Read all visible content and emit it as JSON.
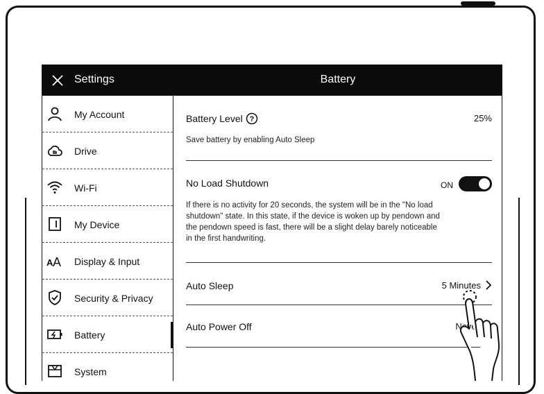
{
  "titlebar": {
    "settings_label": "Settings",
    "page_title": "Battery"
  },
  "sidebar": {
    "items": [
      {
        "label": "My Account",
        "icon": "person-icon"
      },
      {
        "label": "Drive",
        "icon": "cloud-icon"
      },
      {
        "label": "Wi-Fi",
        "icon": "wifi-icon"
      },
      {
        "label": "My Device",
        "icon": "device-icon"
      },
      {
        "label": "Display & Input",
        "icon": "text-size-icon"
      },
      {
        "label": "Security & Privacy",
        "icon": "shield-icon"
      },
      {
        "label": "Battery",
        "icon": "battery-icon",
        "active": true
      },
      {
        "label": "System",
        "icon": "system-icon"
      }
    ]
  },
  "battery_level": {
    "title": "Battery Level",
    "value": "25%",
    "desc": "Save battery by enabling Auto Sleep"
  },
  "no_load_shutdown": {
    "title": "No Load Shutdown",
    "toggle_label": "ON",
    "desc": "If there is no activity for 20 seconds, the system will be in the \"No load shutdown\" state. In this state, if the device is woken up by pendown and the pendown speed is fast, there will be a slight delay barely noticeable in the first handwriting."
  },
  "auto_sleep": {
    "title": "Auto Sleep",
    "value": "5 Minutes"
  },
  "auto_power_off": {
    "title": "Auto Power Off",
    "value": "Never"
  }
}
